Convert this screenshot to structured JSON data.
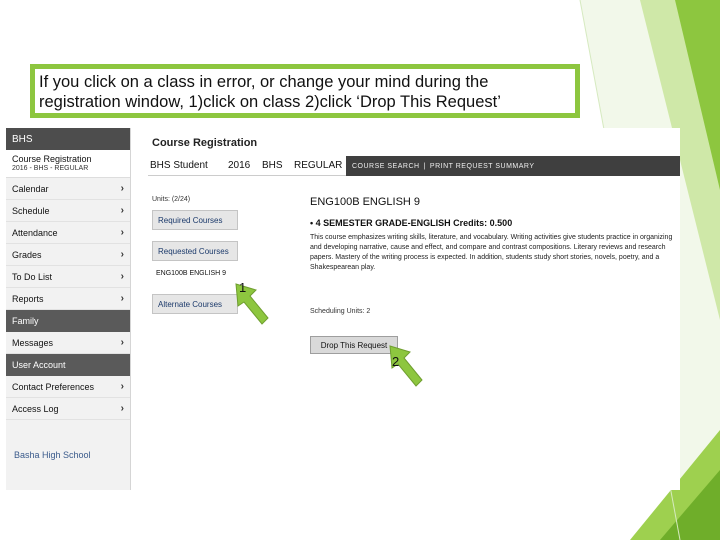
{
  "slide": {
    "callout_line1": "If you click on a class in error, or change your mind during the",
    "callout_line2": "registration window, 1)click on class 2)click ‘Drop This Request’",
    "accent_color": "#8dc63f"
  },
  "sidebar": {
    "header": "BHS",
    "course_title": "Course Registration",
    "course_subtitle": "2016 - BHS - REGULAR",
    "items": [
      {
        "label": "Calendar"
      },
      {
        "label": "Schedule"
      },
      {
        "label": "Attendance"
      },
      {
        "label": "Grades"
      },
      {
        "label": "To Do List"
      },
      {
        "label": "Reports"
      }
    ],
    "section_family": "Family",
    "messages": "Messages",
    "section_user": "User Account",
    "contact": "Contact Preferences",
    "access": "Access Log",
    "school": "Basha High School"
  },
  "main": {
    "title": "Course Registration",
    "info": {
      "student": "BHS Student",
      "year": "2016",
      "school": "BHS",
      "type": "REGULAR"
    },
    "tabs": {
      "course_search": "COURSE SEARCH",
      "sep": "|",
      "print_summary": "PRINT REQUEST SUMMARY"
    },
    "units": "Units: (2/24)",
    "buttons": {
      "required": "Required Courses",
      "requested": "Requested Courses",
      "alternate": "Alternate Courses"
    },
    "course_item": "ENG100B ENGLISH 9",
    "detail": {
      "title": "ENG100B ENGLISH 9",
      "subtitle": "• 4 SEMESTER GRADE-ENGLISH Credits: 0.500",
      "description": "This course emphasizes writing skills, literature, and vocabulary. Writing activities give students practice in organizing and developing narrative, cause and effect, and compare and contrast compositions. Literary reviews and research papers. Mastery of the writing process is expected. In addition, students study short stories, novels, poetry, and a Shakespearean play.",
      "scheduling_units": "Scheduling Units: 2",
      "drop_button": "Drop This Request"
    }
  },
  "annotations": {
    "arrow1": "1",
    "arrow2": "2"
  }
}
